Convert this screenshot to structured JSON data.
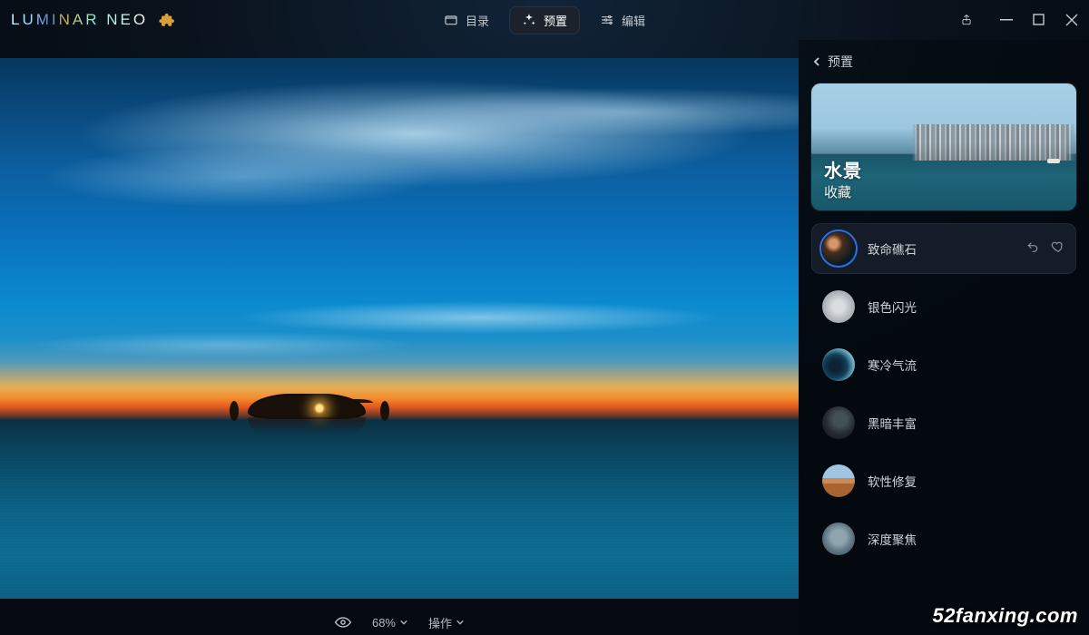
{
  "app": {
    "name": "LUMINAR NEO"
  },
  "nav": {
    "catalog": "目录",
    "presets": "预置",
    "edit": "编辑",
    "active": "presets"
  },
  "canvas": {
    "zoom_label": "68%",
    "operations_label": "操作"
  },
  "sidebar": {
    "header": "预置",
    "hero": {
      "title": "水景",
      "subtitle": "收藏"
    },
    "presets": [
      {
        "label": "致命礁石",
        "selected": true
      },
      {
        "label": "银色闪光",
        "selected": false
      },
      {
        "label": "寒冷气流",
        "selected": false
      },
      {
        "label": "黑暗丰富",
        "selected": false
      },
      {
        "label": "软性修复",
        "selected": false
      },
      {
        "label": "深度聚焦",
        "selected": false
      }
    ]
  },
  "watermark": "52fanxing.com"
}
